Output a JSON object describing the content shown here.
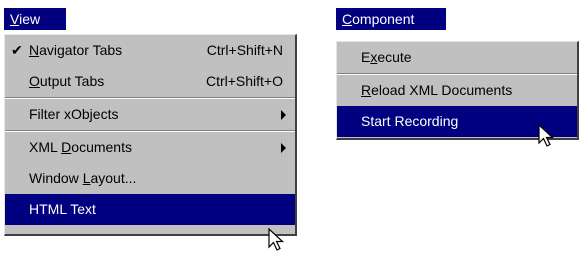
{
  "view_menu": {
    "title_mnemonic": "V",
    "title_rest": "iew",
    "items": [
      {
        "checked": true,
        "pre": "",
        "mn": "N",
        "post": "avigator Tabs",
        "shortcut": "Ctrl+Shift+N"
      },
      {
        "checked": false,
        "pre": "",
        "mn": "O",
        "post": "utput Tabs",
        "shortcut": "Ctrl+Shift+O"
      },
      {
        "label": "Filter xObjects"
      },
      {
        "pre": "XML ",
        "mn": "D",
        "post": "ocuments"
      },
      {
        "pre": "Window ",
        "mn": "L",
        "post": "ayout..."
      },
      {
        "label": "HTML Text"
      }
    ],
    "check_glyph": "✔"
  },
  "component_menu": {
    "title_mnemonic": "C",
    "title_rest": "omponent",
    "items": [
      {
        "pre": "E",
        "mn": "x",
        "post": "ecute"
      },
      {
        "pre": "",
        "mn": "R",
        "post": "eload XML Documents"
      },
      {
        "label": "Start Recording"
      }
    ]
  },
  "colors": {
    "highlight": "#000080",
    "menu_bg": "#c0c0c0"
  },
  "icons": [
    "checkmark-icon",
    "submenu-arrow-icon",
    "mouse-pointer-icon"
  ]
}
